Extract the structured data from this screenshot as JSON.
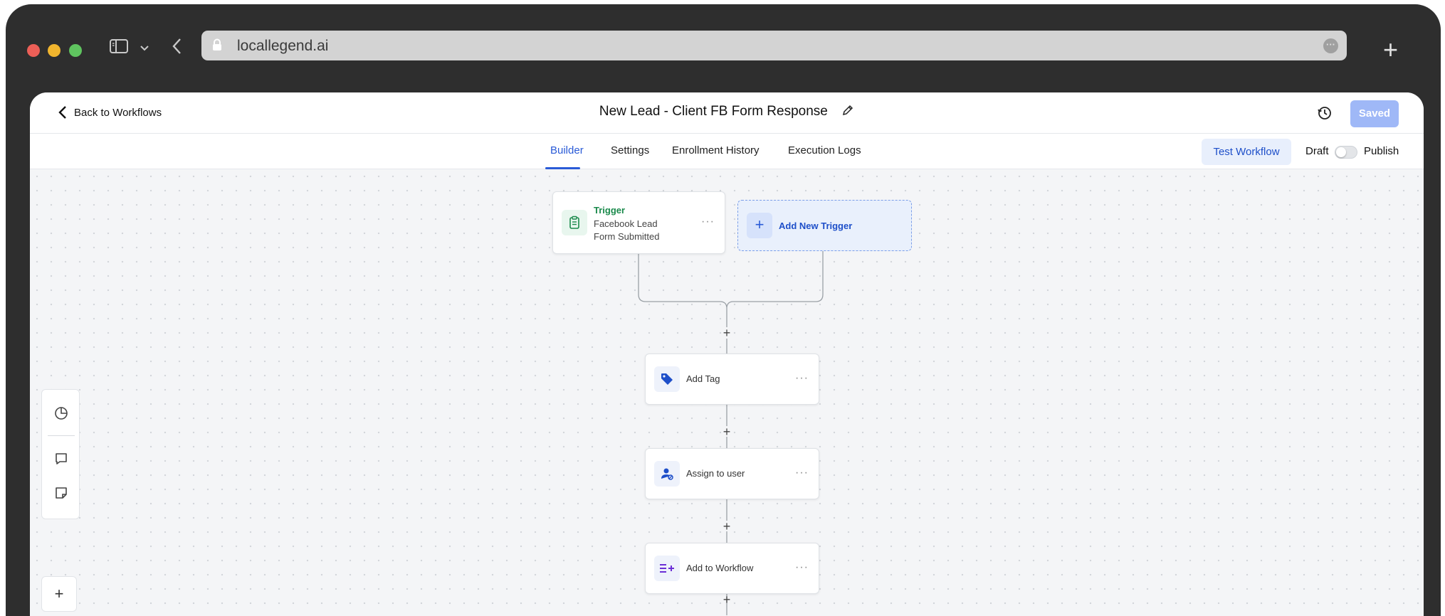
{
  "browser": {
    "url": "locallegend.ai"
  },
  "header": {
    "back_label": "Back to Workflows",
    "title": "New Lead - Client FB Form Response",
    "saved_label": "Saved"
  },
  "subnav": {
    "tabs": [
      {
        "label": "Builder",
        "active": true
      },
      {
        "label": "Settings",
        "active": false
      },
      {
        "label": "Enrollment History",
        "active": false
      },
      {
        "label": "Execution Logs",
        "active": false
      }
    ],
    "test_workflow_label": "Test Workflow",
    "draft_label": "Draft",
    "publish_label": "Publish",
    "published": false
  },
  "canvas": {
    "trigger": {
      "title": "Trigger",
      "subtitle": "Facebook Lead Form Submitted",
      "icon": "clipboard-icon"
    },
    "add_trigger_label": "Add New Trigger",
    "actions": [
      {
        "label": "Add Tag",
        "icon": "tag-icon"
      },
      {
        "label": "Assign to user",
        "icon": "user-assign-icon"
      },
      {
        "label": "Add to Workflow",
        "icon": "add-workflow-icon"
      }
    ],
    "more_glyph": "···",
    "plus_glyph": "+"
  },
  "colors": {
    "accent": "#2a5bd7",
    "trigger_green": "#1b8a4c",
    "saved_button": "#9fb8f7",
    "workflow_purple": "#6b2fd6"
  }
}
